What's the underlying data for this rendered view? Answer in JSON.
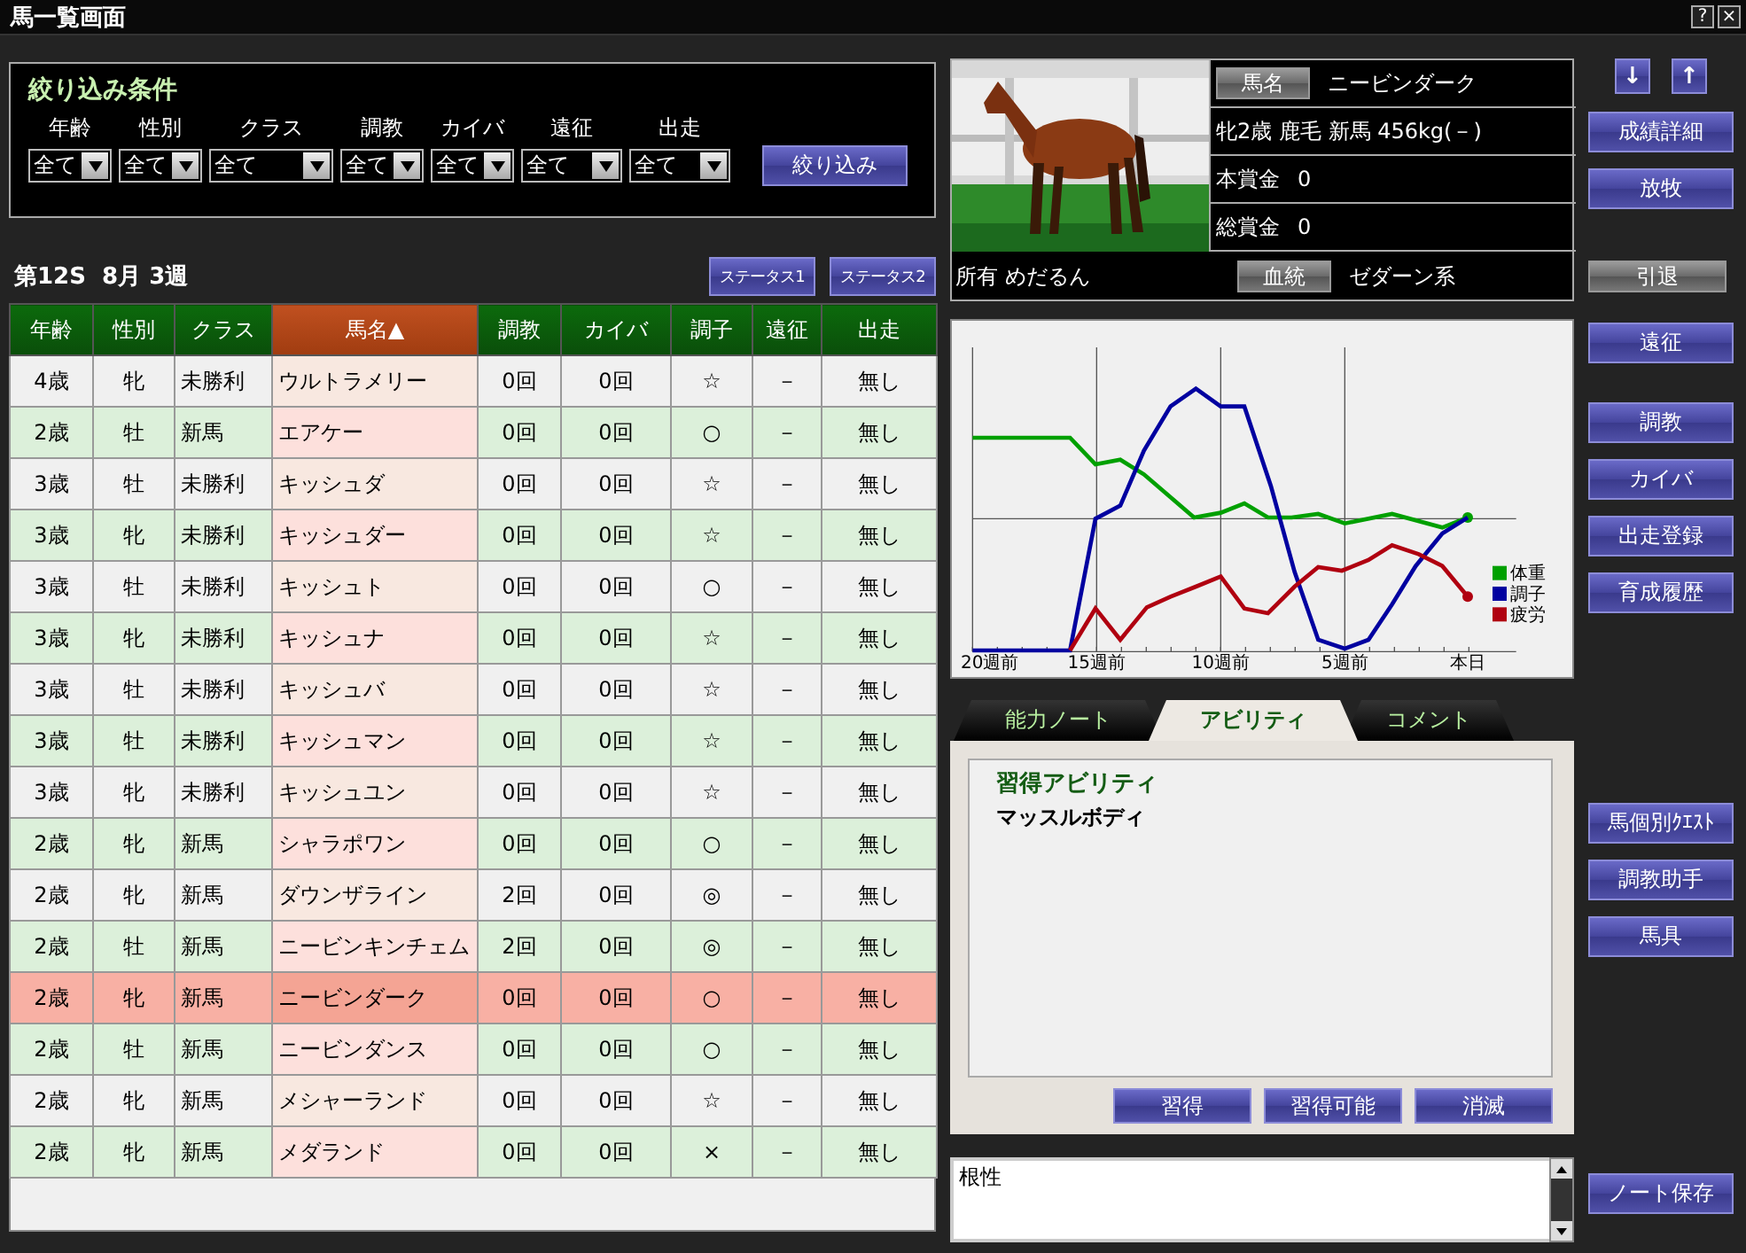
{
  "window": {
    "title": "馬一覧画面",
    "buttons": [
      "?",
      "×"
    ]
  },
  "filter": {
    "title": "絞り込み条件",
    "fields": [
      {
        "label": "年齢",
        "value": "全て"
      },
      {
        "label": "性別",
        "value": "全て"
      },
      {
        "label": "クラス",
        "value": "全て"
      },
      {
        "label": "調教",
        "value": "全て"
      },
      {
        "label": "カイバ",
        "value": "全て"
      },
      {
        "label": "遠征",
        "value": "全て"
      },
      {
        "label": "出走",
        "value": "全て"
      }
    ],
    "button": "絞り込み"
  },
  "period": "第12S  8月 3週",
  "status_buttons": [
    "ステータス1",
    "ステータス2"
  ],
  "table": {
    "sort_mark": "▲",
    "columns": [
      {
        "label": "年齢",
        "sorted": false
      },
      {
        "label": "性別",
        "sorted": false
      },
      {
        "label": "クラス",
        "sorted": false
      },
      {
        "label": "馬名",
        "sorted": true
      },
      {
        "label": "調教",
        "sorted": false
      },
      {
        "label": "カイバ",
        "sorted": false
      },
      {
        "label": "調子",
        "sorted": false
      },
      {
        "label": "遠征",
        "sorted": false
      },
      {
        "label": "出走",
        "sorted": false
      }
    ],
    "rows": [
      {
        "cells": [
          "4歳",
          "牝",
          "未勝利",
          "ウルトラメリー",
          "0回",
          "0回",
          "☆",
          "－",
          "無し"
        ],
        "selected": false
      },
      {
        "cells": [
          "2歳",
          "牡",
          "新馬",
          "エアケー",
          "0回",
          "0回",
          "○",
          "－",
          "無し"
        ],
        "selected": false
      },
      {
        "cells": [
          "3歳",
          "牡",
          "未勝利",
          "キッシュダ",
          "0回",
          "0回",
          "☆",
          "－",
          "無し"
        ],
        "selected": false
      },
      {
        "cells": [
          "3歳",
          "牝",
          "未勝利",
          "キッシュダー",
          "0回",
          "0回",
          "☆",
          "－",
          "無し"
        ],
        "selected": false
      },
      {
        "cells": [
          "3歳",
          "牡",
          "未勝利",
          "キッシュト",
          "0回",
          "0回",
          "○",
          "－",
          "無し"
        ],
        "selected": false
      },
      {
        "cells": [
          "3歳",
          "牝",
          "未勝利",
          "キッシュナ",
          "0回",
          "0回",
          "☆",
          "－",
          "無し"
        ],
        "selected": false
      },
      {
        "cells": [
          "3歳",
          "牡",
          "未勝利",
          "キッシュバ",
          "0回",
          "0回",
          "☆",
          "－",
          "無し"
        ],
        "selected": false
      },
      {
        "cells": [
          "3歳",
          "牡",
          "未勝利",
          "キッシュマン",
          "0回",
          "0回",
          "☆",
          "－",
          "無し"
        ],
        "selected": false
      },
      {
        "cells": [
          "3歳",
          "牝",
          "未勝利",
          "キッシュユン",
          "0回",
          "0回",
          "☆",
          "－",
          "無し"
        ],
        "selected": false
      },
      {
        "cells": [
          "2歳",
          "牝",
          "新馬",
          "シャラポワン",
          "0回",
          "0回",
          "○",
          "－",
          "無し"
        ],
        "selected": false
      },
      {
        "cells": [
          "2歳",
          "牝",
          "新馬",
          "ダウンザライン",
          "2回",
          "0回",
          "◎",
          "－",
          "無し"
        ],
        "selected": false
      },
      {
        "cells": [
          "2歳",
          "牡",
          "新馬",
          "ニービンキンチェム",
          "2回",
          "0回",
          "◎",
          "－",
          "無し"
        ],
        "selected": false
      },
      {
        "cells": [
          "2歳",
          "牝",
          "新馬",
          "ニービンダーク",
          "0回",
          "0回",
          "○",
          "－",
          "無し"
        ],
        "selected": true
      },
      {
        "cells": [
          "2歳",
          "牡",
          "新馬",
          "ニービンダンス",
          "0回",
          "0回",
          "○",
          "－",
          "無し"
        ],
        "selected": false
      },
      {
        "cells": [
          "2歳",
          "牝",
          "新馬",
          "メシャーランド",
          "0回",
          "0回",
          "☆",
          "－",
          "無し"
        ],
        "selected": false
      },
      {
        "cells": [
          "2歳",
          "牝",
          "新馬",
          "メダランド",
          "0回",
          "0回",
          "×",
          "－",
          "無し"
        ],
        "selected": false
      }
    ]
  },
  "horse": {
    "name_button": "馬名",
    "name": "ニービンダーク",
    "profile": "牝2歳 鹿毛 新馬 456kg(－)",
    "prizes": [
      {
        "label": "本賞金",
        "value": "0"
      },
      {
        "label": "総賞金",
        "value": "0"
      }
    ],
    "owner": "所有 めだるん",
    "lineage_button": "血統",
    "lineage": "ゼダーン系"
  },
  "chart": {
    "x_labels": [
      "20週前",
      "15週前",
      "10週前",
      "5週前",
      "本日"
    ],
    "legend": [
      {
        "label": "体重",
        "color": "#00a000"
      },
      {
        "label": "調子",
        "color": "#0000a0"
      },
      {
        "label": "疲労",
        "color": "#b00010"
      }
    ]
  },
  "tabs": [
    {
      "label": "能力ノート",
      "selected": false
    },
    {
      "label": "アビリティ",
      "selected": true
    },
    {
      "label": "コメント",
      "selected": false
    }
  ],
  "abilities": {
    "heading": "習得アビリティ",
    "items": [
      "マッスルボディ"
    ],
    "buttons": [
      "習得",
      "習得可能",
      "消滅"
    ]
  },
  "note": {
    "value": "根性"
  },
  "side_buttons": [
    [
      {
        "label": "↓",
        "kind": "blue"
      },
      {
        "label": "↑",
        "kind": "blue"
      }
    ],
    [
      {
        "label": "成績詳細",
        "kind": "blue"
      },
      {
        "label": "放牧",
        "kind": "blue"
      }
    ],
    [
      {
        "label": "引退",
        "kind": "grey"
      }
    ],
    [
      {
        "label": "遠征",
        "kind": "blue"
      }
    ],
    [
      {
        "label": "調教",
        "kind": "blue"
      },
      {
        "label": "カイバ",
        "kind": "blue"
      },
      {
        "label": "出走登録",
        "kind": "blue"
      },
      {
        "label": "育成履歴",
        "kind": "blue"
      }
    ],
    [
      {
        "label": "馬個別ｸｴｽﾄ",
        "kind": "blue"
      },
      {
        "label": "調教助手",
        "kind": "blue"
      },
      {
        "label": "馬具",
        "kind": "blue"
      }
    ],
    [
      {
        "label": "ノート保存",
        "kind": "blue"
      }
    ]
  ]
}
